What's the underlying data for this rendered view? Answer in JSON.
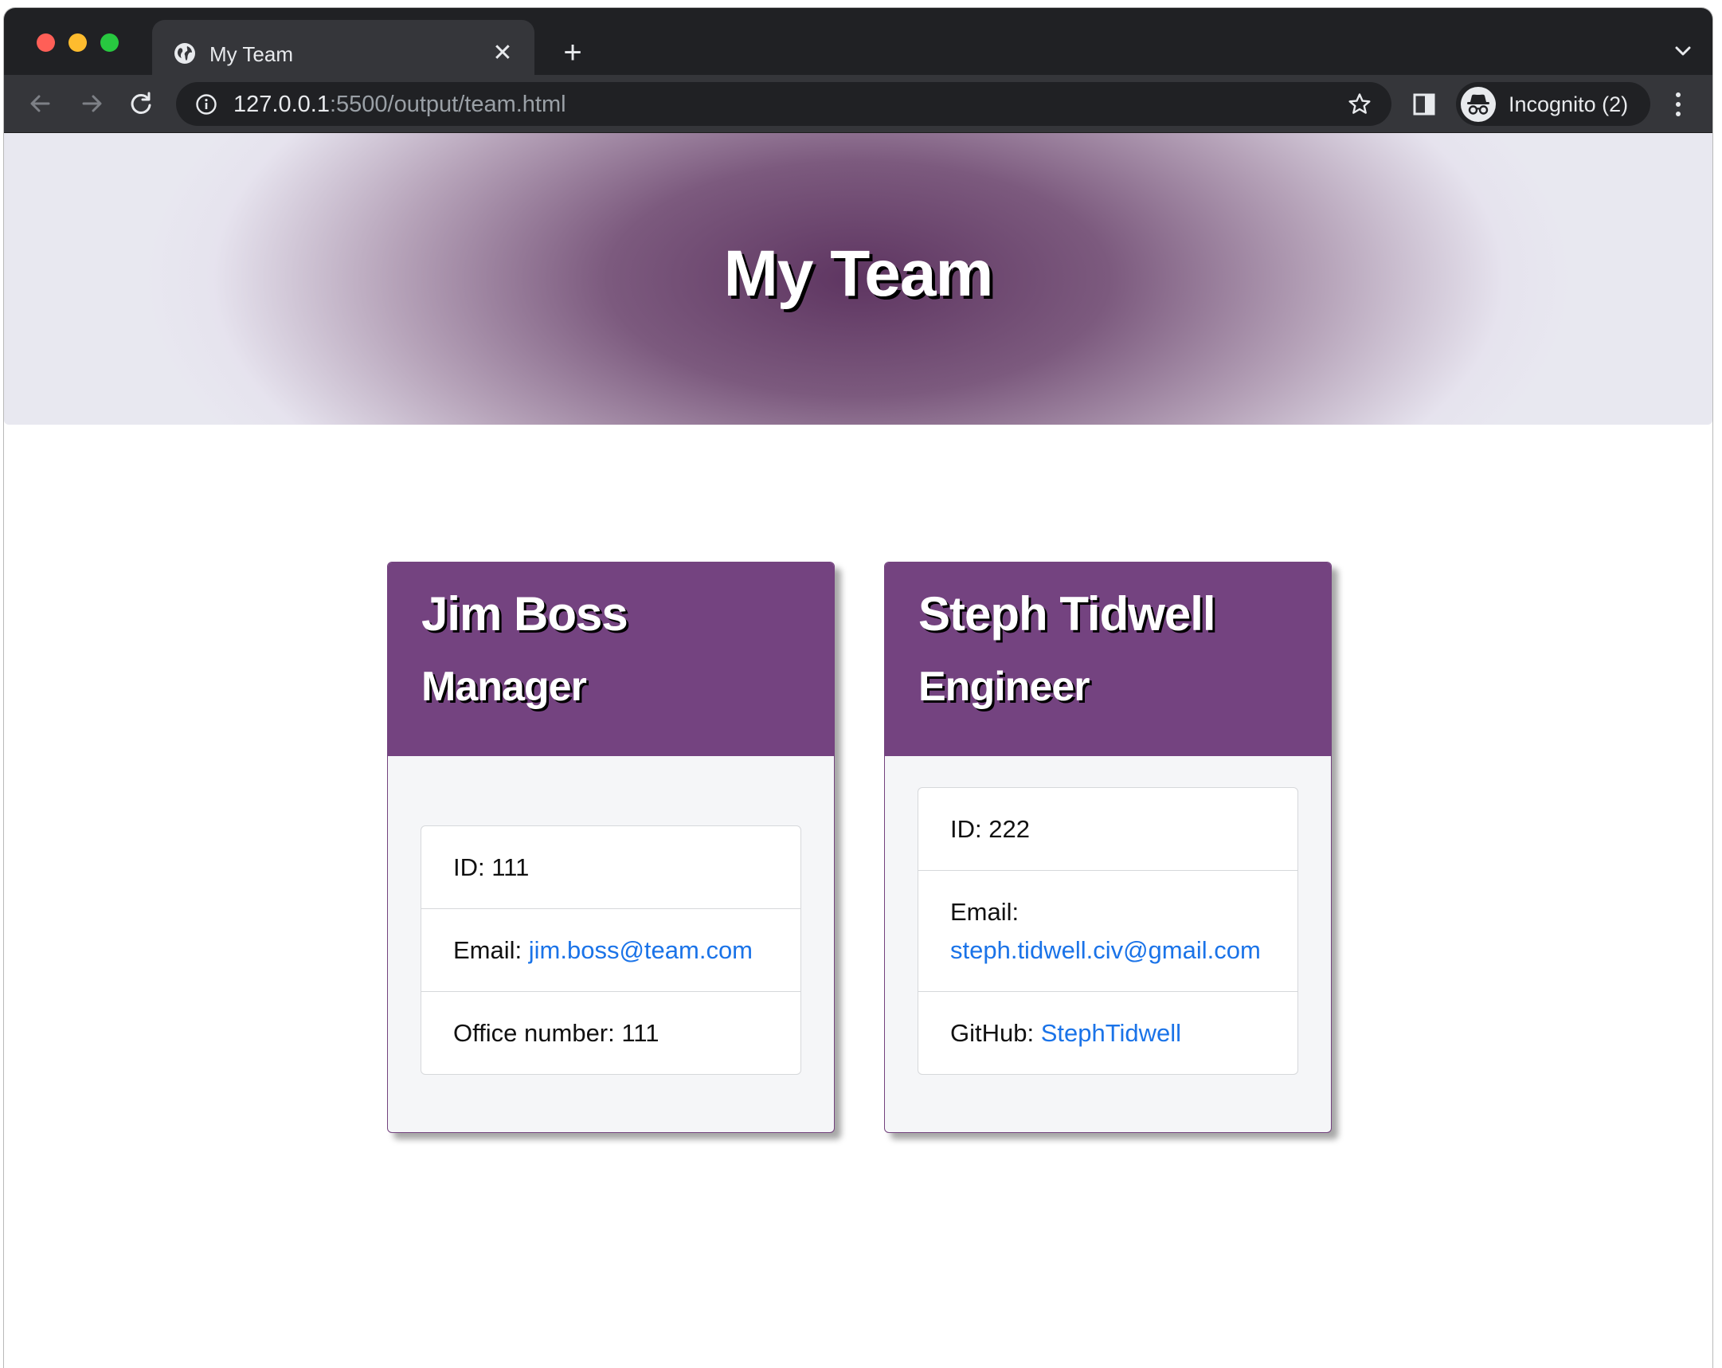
{
  "browser": {
    "tab_title": "My Team",
    "url_host": "127.0.0.1",
    "url_rest": ":5500/output/team.html",
    "profile_label": "Incognito (2)"
  },
  "page": {
    "title": "My Team"
  },
  "team": [
    {
      "name": "Jim Boss",
      "role": "Manager",
      "id_label": "ID: 111",
      "email_prefix": "Email: ",
      "email": "jim.boss@team.com",
      "extra_prefix": "Office number: 111",
      "extra_value": ""
    },
    {
      "name": "Steph Tidwell",
      "role": "Engineer",
      "id_label": "ID: 222",
      "email_prefix": "Email: ",
      "email": "steph.tidwell.civ@gmail.com",
      "extra_prefix": "GitHub: ",
      "extra_value": "StephTidwell"
    }
  ],
  "colors": {
    "card_header": "#744380",
    "link": "#1a73e8",
    "chrome_dark": "#202124",
    "chrome_toolbar": "#35363a"
  },
  "icons": {
    "tab_favicon": "globe-icon",
    "close": "close-icon",
    "new_tab": "plus-icon",
    "back": "arrow-left-icon",
    "forward": "arrow-right-icon",
    "reload": "reload-icon",
    "site_info": "info-icon",
    "bookmark": "star-icon",
    "side_panel": "side-panel-icon",
    "incognito": "incognito-icon",
    "menu": "kebab-menu-icon"
  }
}
